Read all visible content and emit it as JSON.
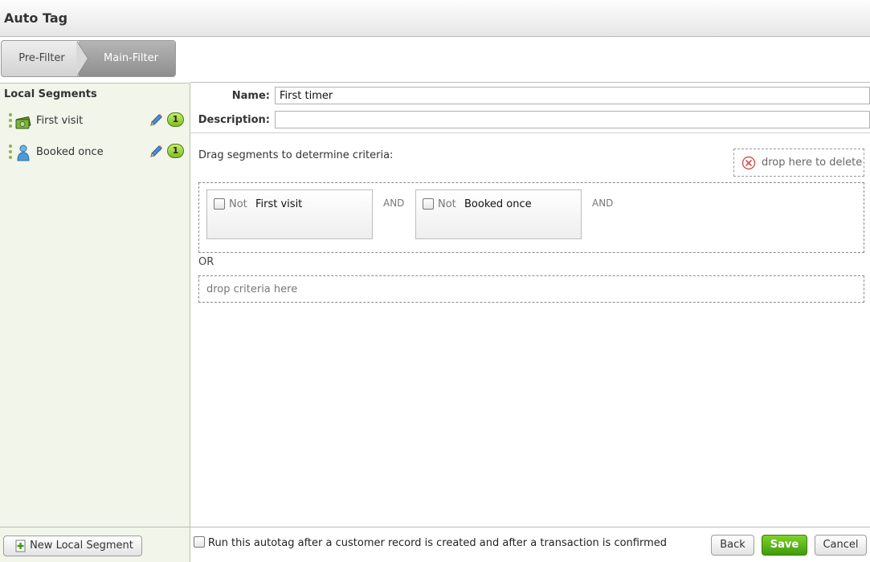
{
  "window": {
    "title": "Auto Tag"
  },
  "steps": {
    "pre_filter": "Pre-Filter",
    "main_filter": "Main-Filter",
    "active": "Main-Filter"
  },
  "sidebar": {
    "heading": "Local Segments",
    "items": [
      {
        "label": "First visit",
        "icon": "money-icon",
        "count": "1"
      },
      {
        "label": "Booked once",
        "icon": "person-icon",
        "count": "1"
      }
    ],
    "new_button": "New Local Segment"
  },
  "form": {
    "name_label": "Name:",
    "name_value": "First timer",
    "description_label": "Description:",
    "description_value": ""
  },
  "criteria": {
    "hint": "Drag segments to determine criteria:",
    "delete_zone": "drop here to delete",
    "rows": [
      {
        "items": [
          {
            "not_label": "Not",
            "name": "First visit",
            "negated": false
          },
          {
            "not_label": "Not",
            "name": "Booked once",
            "negated": false
          }
        ],
        "connectors": [
          "AND",
          "AND"
        ]
      }
    ],
    "or_label": "OR",
    "drop_zone": "drop criteria here"
  },
  "footer": {
    "run_label": "Run this autotag after a customer record is created and after a transaction is confirmed",
    "run_checked": false,
    "back": "Back",
    "save": "Save",
    "cancel": "Cancel"
  },
  "colors": {
    "panel_bg": "#f1f5ea",
    "accent_green": "#5fb81a",
    "count_badge": "#9ad63a"
  }
}
